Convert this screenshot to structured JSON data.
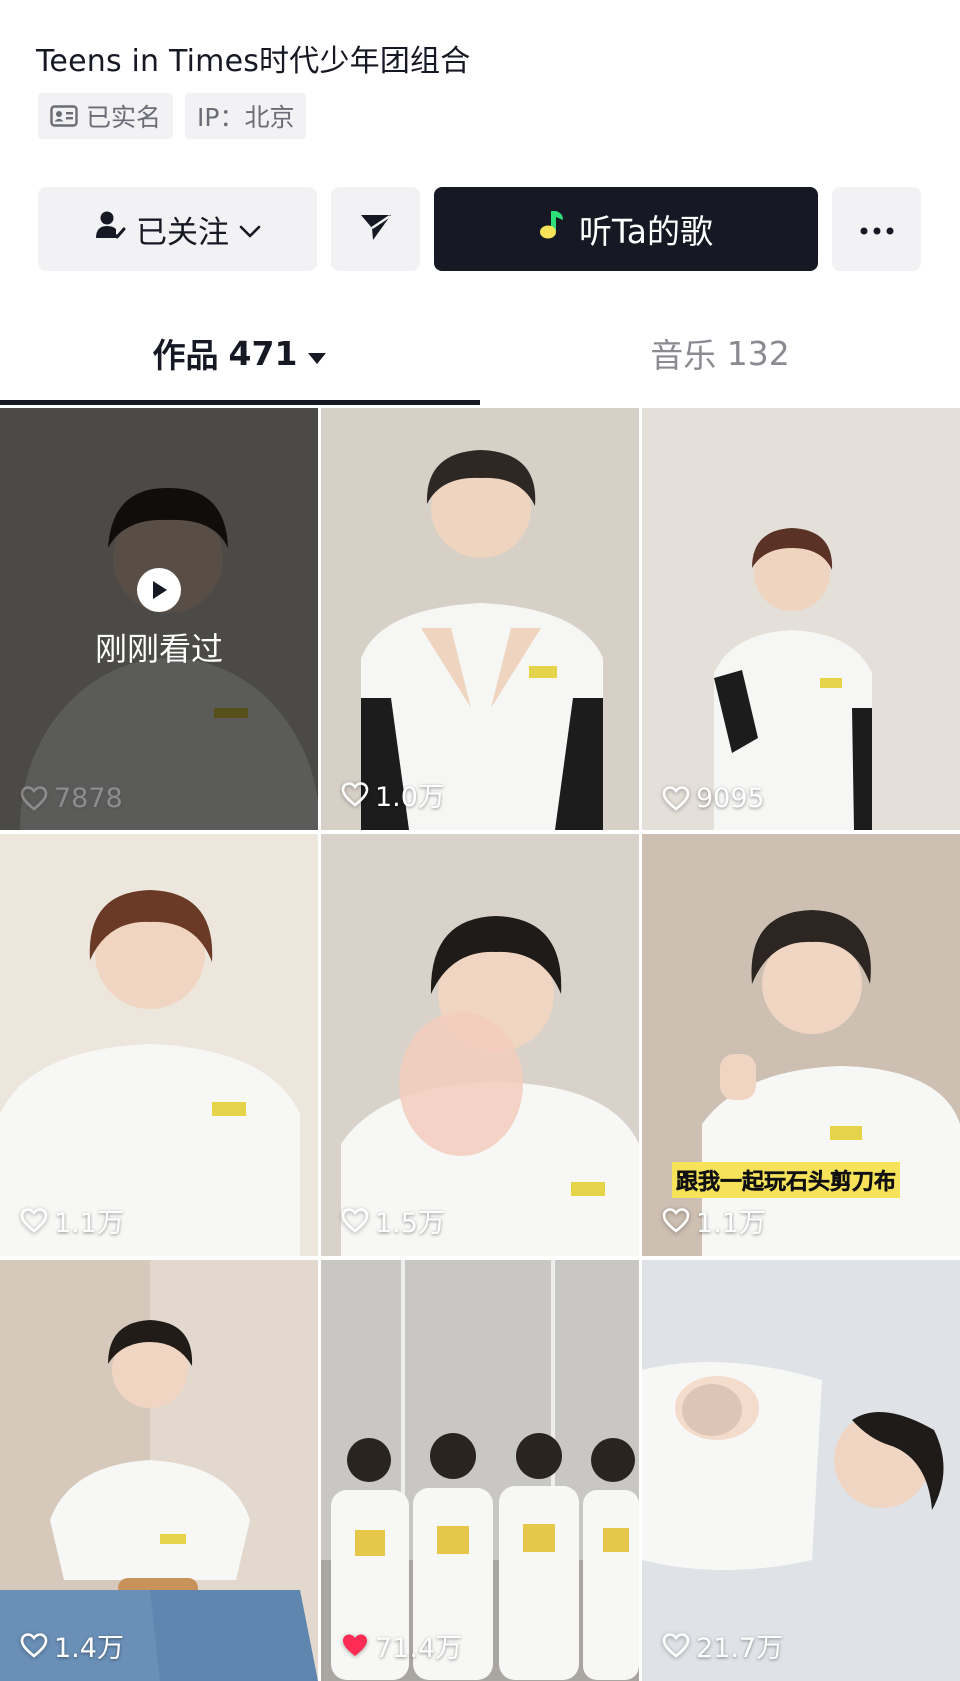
{
  "profile": {
    "name": "Teens in Times时代少年团组合",
    "verified_label": "已实名",
    "ip_label": "IP：北京"
  },
  "actions": {
    "follow_label": "已关注",
    "music_label": "听Ta的歌"
  },
  "tabs": {
    "works_label": "作品",
    "works_count": "471",
    "music_label": "音乐",
    "music_count": "132"
  },
  "videos": [
    {
      "likes": "7878",
      "overlay_text": "刚刚看过",
      "liked": false
    },
    {
      "likes": "1.0万",
      "liked": false
    },
    {
      "likes": "9095",
      "liked": false
    },
    {
      "likes": "1.1万",
      "liked": false
    },
    {
      "likes": "1.5万",
      "liked": false
    },
    {
      "likes": "1.1万",
      "caption": "跟我一起玩石头剪刀布",
      "liked": false
    },
    {
      "likes": "1.4万",
      "liked": false
    },
    {
      "likes": "71.4万",
      "liked": true
    },
    {
      "likes": "21.7万",
      "liked": false
    }
  ],
  "colors": {
    "text_primary": "#161823",
    "text_secondary": "#8a8b91",
    "button_bg": "#f2f2f4",
    "music_button_bg": "#161823",
    "music_icon_green": "#2fe07a",
    "like_active": "#fe2c55"
  }
}
